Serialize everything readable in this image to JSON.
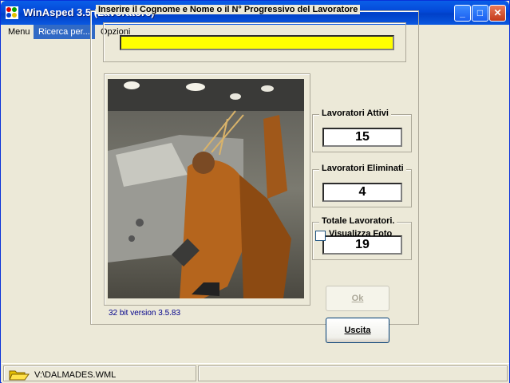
{
  "window": {
    "title": "WinAsped 3.5 (Lavoratore)"
  },
  "menu": {
    "items": [
      "Menu",
      "Ricerca per...",
      "Opzioni"
    ]
  },
  "main": {
    "group_label": "Inserire il Cognome e Nome o il N° Progressivo del Lavoratore",
    "search_value": "",
    "counters": [
      {
        "label": "Lavoratori Attivi",
        "value": "15"
      },
      {
        "label": "Lavoratori Eliminati",
        "value": "4"
      },
      {
        "label": "Totale Lavoratori.",
        "value": "19"
      }
    ],
    "photo_checkbox_label": "Visualizza Foto",
    "photo_checked": false,
    "ok_label": "Ok",
    "ok_enabled": false,
    "exit_label": "Uscita",
    "version": "32 bit version 3.5.83"
  },
  "status": {
    "path": "V:\\DALMADES.WML",
    "icon": "folder-open-icon"
  },
  "colors": {
    "search_bg": "#ffff00",
    "titlebar": "#0348d8",
    "menu_active": "#316ac5",
    "version_text": "#00008b"
  }
}
